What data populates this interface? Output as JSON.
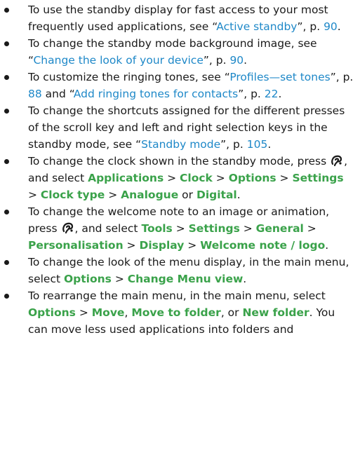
{
  "items": [
    {
      "t1": "To use the standby display for fast access to your most frequently used applications, see “",
      "link1": "Active standby",
      "t2": "”, p. ",
      "page1": "90",
      "t3": "."
    },
    {
      "t1": "To change the standby mode background image, see “",
      "link1": "Change the look of your device",
      "t2": "”, p. ",
      "page1": "90",
      "t3": "."
    },
    {
      "t1": "To customize the ringing tones, see “",
      "link1": "Profiles—set tones",
      "t2": "”, p. ",
      "page1": "88",
      "t3": " and “",
      "link2": "Add ringing tones for contacts",
      "t4": "”, p. ",
      "page2": "22",
      "t5": "."
    },
    {
      "t1": "To change the shortcuts assigned for the different presses of the scroll key and left and right selection keys in the standby mode, see “",
      "link1": "Standby mode",
      "t2": "”, p. ",
      "page1": "105",
      "t3": "."
    },
    {
      "t1": "To change the clock shown in the standby mode, press ",
      "t2": ", and select ",
      "b1": "Applications",
      "b2": "Clock",
      "b3": "Options",
      "b4": "Settings",
      "b5": "Clock type",
      "b6": "Analogue",
      "or": " or ",
      "b7": "Digital",
      "end": "."
    },
    {
      "t1": "To change the welcome note to an image or animation, press ",
      "t2": ", and select ",
      "b1": "Tools",
      "b2": "Settings",
      "b3": "General",
      "b4": "Personalisation",
      "b5": "Display",
      "b6": "Welcome note / logo",
      "end": "."
    },
    {
      "t1": "To change the look of the menu display, in the main menu, select ",
      "b1": "Options",
      "b2": "Change Menu view",
      "end": "."
    },
    {
      "t1": "To rearrange the main menu, in the main menu, select ",
      "b1": "Options",
      "b2": "Move",
      "c1": ", ",
      "b3": "Move to folder",
      "c2": ", or ",
      "b4": "New folder",
      "t2": ". You can move less used applications into folders and"
    }
  ],
  "sep": " > ",
  "colors": {
    "link": "#1e88c8",
    "menu_term": "#3aa24a",
    "text": "#1a1a1a"
  },
  "icons": {
    "menu_key": "menu-key-icon"
  }
}
